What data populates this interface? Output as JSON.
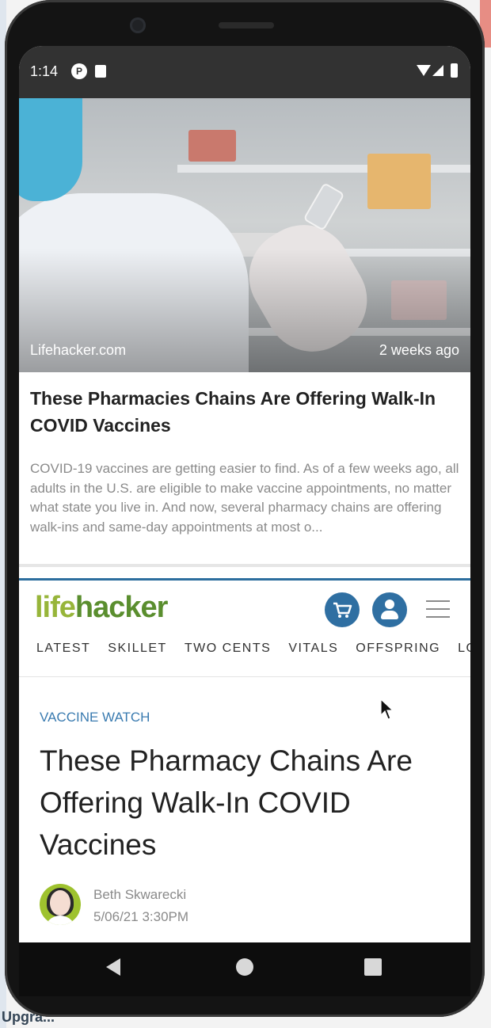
{
  "status_bar": {
    "time": "1:14",
    "notif_icon_letter": "P",
    "icons": [
      "p-notification-icon",
      "sd-card-icon",
      "wifi-icon",
      "signal-icon",
      "battery-icon"
    ]
  },
  "card": {
    "source": "Lifehacker.com",
    "age": "2 weeks ago",
    "title": "These Pharmacies Chains Are Offering Walk-In COVID Vaccines",
    "summary": "COVID-19 vaccines are getting easier to find. As of a few weeks ago, all adults in the U.S. are eligible to make vaccine appointments, no matter what state you live in. And now, several pharmacy chains are offering walk-ins and same-day appointments at most o..."
  },
  "site": {
    "logo_part1": "life",
    "logo_part2": "hacker",
    "nav": [
      "LATEST",
      "SKILLET",
      "TWO CENTS",
      "VITALS",
      "OFFSPRING",
      "LOD"
    ],
    "colors": {
      "accent": "#2f6fa2",
      "logo_light": "#97b53a",
      "logo_dark": "#5a8e2e",
      "kicker": "#3a7bb0"
    }
  },
  "article": {
    "kicker": "VACCINE WATCH",
    "headline": "These Pharmacy Chains Are Offering Walk-In COVID Vaccines",
    "author": "Beth Skwarecki",
    "date": "5/06/21 3:30PM"
  },
  "background": {
    "bottom_text": "Upgra..."
  }
}
